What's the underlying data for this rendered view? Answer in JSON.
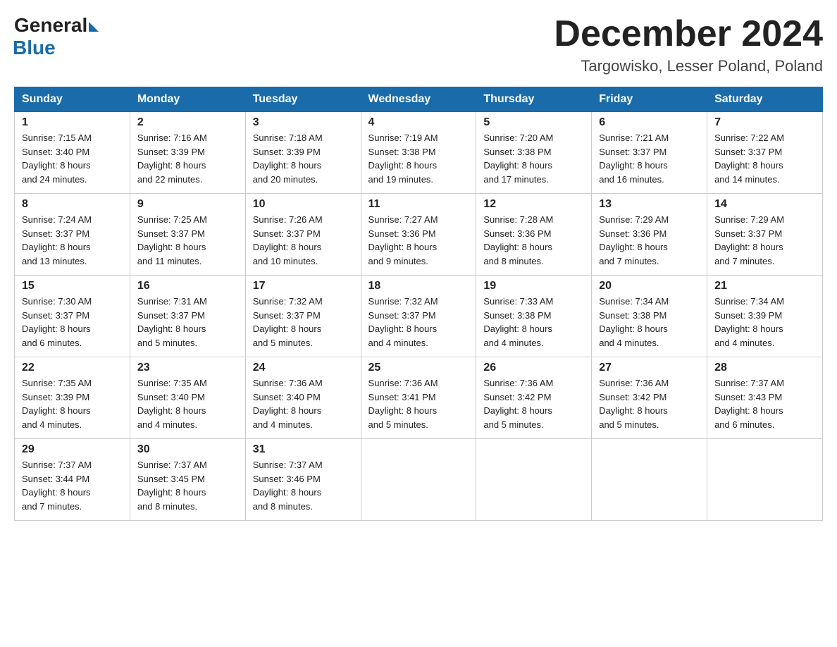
{
  "header": {
    "logo": {
      "general": "General",
      "blue": "Blue"
    },
    "title": "December 2024",
    "location": "Targowisko, Lesser Poland, Poland"
  },
  "weekdays": [
    "Sunday",
    "Monday",
    "Tuesday",
    "Wednesday",
    "Thursday",
    "Friday",
    "Saturday"
  ],
  "weeks": [
    [
      {
        "day": "1",
        "sunrise": "7:15 AM",
        "sunset": "3:40 PM",
        "daylight": "8 hours and 24 minutes."
      },
      {
        "day": "2",
        "sunrise": "7:16 AM",
        "sunset": "3:39 PM",
        "daylight": "8 hours and 22 minutes."
      },
      {
        "day": "3",
        "sunrise": "7:18 AM",
        "sunset": "3:39 PM",
        "daylight": "8 hours and 20 minutes."
      },
      {
        "day": "4",
        "sunrise": "7:19 AM",
        "sunset": "3:38 PM",
        "daylight": "8 hours and 19 minutes."
      },
      {
        "day": "5",
        "sunrise": "7:20 AM",
        "sunset": "3:38 PM",
        "daylight": "8 hours and 17 minutes."
      },
      {
        "day": "6",
        "sunrise": "7:21 AM",
        "sunset": "3:37 PM",
        "daylight": "8 hours and 16 minutes."
      },
      {
        "day": "7",
        "sunrise": "7:22 AM",
        "sunset": "3:37 PM",
        "daylight": "8 hours and 14 minutes."
      }
    ],
    [
      {
        "day": "8",
        "sunrise": "7:24 AM",
        "sunset": "3:37 PM",
        "daylight": "8 hours and 13 minutes."
      },
      {
        "day": "9",
        "sunrise": "7:25 AM",
        "sunset": "3:37 PM",
        "daylight": "8 hours and 11 minutes."
      },
      {
        "day": "10",
        "sunrise": "7:26 AM",
        "sunset": "3:37 PM",
        "daylight": "8 hours and 10 minutes."
      },
      {
        "day": "11",
        "sunrise": "7:27 AM",
        "sunset": "3:36 PM",
        "daylight": "8 hours and 9 minutes."
      },
      {
        "day": "12",
        "sunrise": "7:28 AM",
        "sunset": "3:36 PM",
        "daylight": "8 hours and 8 minutes."
      },
      {
        "day": "13",
        "sunrise": "7:29 AM",
        "sunset": "3:36 PM",
        "daylight": "8 hours and 7 minutes."
      },
      {
        "day": "14",
        "sunrise": "7:29 AM",
        "sunset": "3:37 PM",
        "daylight": "8 hours and 7 minutes."
      }
    ],
    [
      {
        "day": "15",
        "sunrise": "7:30 AM",
        "sunset": "3:37 PM",
        "daylight": "8 hours and 6 minutes."
      },
      {
        "day": "16",
        "sunrise": "7:31 AM",
        "sunset": "3:37 PM",
        "daylight": "8 hours and 5 minutes."
      },
      {
        "day": "17",
        "sunrise": "7:32 AM",
        "sunset": "3:37 PM",
        "daylight": "8 hours and 5 minutes."
      },
      {
        "day": "18",
        "sunrise": "7:32 AM",
        "sunset": "3:37 PM",
        "daylight": "8 hours and 4 minutes."
      },
      {
        "day": "19",
        "sunrise": "7:33 AM",
        "sunset": "3:38 PM",
        "daylight": "8 hours and 4 minutes."
      },
      {
        "day": "20",
        "sunrise": "7:34 AM",
        "sunset": "3:38 PM",
        "daylight": "8 hours and 4 minutes."
      },
      {
        "day": "21",
        "sunrise": "7:34 AM",
        "sunset": "3:39 PM",
        "daylight": "8 hours and 4 minutes."
      }
    ],
    [
      {
        "day": "22",
        "sunrise": "7:35 AM",
        "sunset": "3:39 PM",
        "daylight": "8 hours and 4 minutes."
      },
      {
        "day": "23",
        "sunrise": "7:35 AM",
        "sunset": "3:40 PM",
        "daylight": "8 hours and 4 minutes."
      },
      {
        "day": "24",
        "sunrise": "7:36 AM",
        "sunset": "3:40 PM",
        "daylight": "8 hours and 4 minutes."
      },
      {
        "day": "25",
        "sunrise": "7:36 AM",
        "sunset": "3:41 PM",
        "daylight": "8 hours and 5 minutes."
      },
      {
        "day": "26",
        "sunrise": "7:36 AM",
        "sunset": "3:42 PM",
        "daylight": "8 hours and 5 minutes."
      },
      {
        "day": "27",
        "sunrise": "7:36 AM",
        "sunset": "3:42 PM",
        "daylight": "8 hours and 5 minutes."
      },
      {
        "day": "28",
        "sunrise": "7:37 AM",
        "sunset": "3:43 PM",
        "daylight": "8 hours and 6 minutes."
      }
    ],
    [
      {
        "day": "29",
        "sunrise": "7:37 AM",
        "sunset": "3:44 PM",
        "daylight": "8 hours and 7 minutes."
      },
      {
        "day": "30",
        "sunrise": "7:37 AM",
        "sunset": "3:45 PM",
        "daylight": "8 hours and 8 minutes."
      },
      {
        "day": "31",
        "sunrise": "7:37 AM",
        "sunset": "3:46 PM",
        "daylight": "8 hours and 8 minutes."
      },
      null,
      null,
      null,
      null
    ]
  ],
  "labels": {
    "sunrise": "Sunrise:",
    "sunset": "Sunset:",
    "daylight": "Daylight:"
  }
}
